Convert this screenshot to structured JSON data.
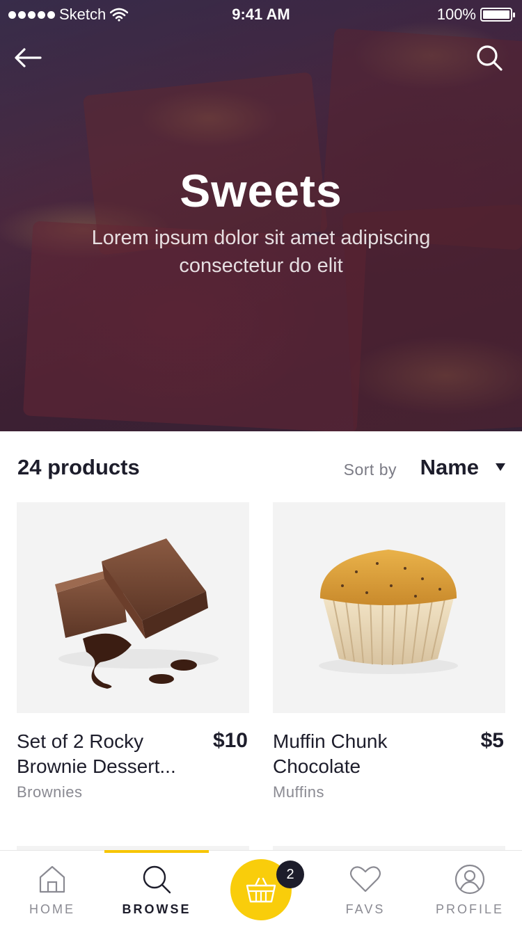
{
  "status_bar": {
    "carrier": "Sketch",
    "time": "9:41 AM",
    "battery": "100%"
  },
  "hero": {
    "title": "Sweets",
    "subtitle": "Lorem ipsum dolor sit amet adipiscing consectetur do elit",
    "back_icon": "arrow-left-icon",
    "search_icon": "search-icon"
  },
  "list": {
    "count": "24 products",
    "sort_label": "Sort by",
    "sort_value": "Name"
  },
  "products": [
    {
      "name_line1": "Set of 2 Rocky",
      "name_line2": "Brownie Dessert...",
      "price": "$10",
      "category": "Brownies"
    },
    {
      "name_line1": "Muffin Chunk",
      "name_line2": "Chocolate",
      "price": "$5",
      "category": "Muffins"
    }
  ],
  "tabbar": {
    "tabs": [
      {
        "label": "HOME",
        "icon": "home-icon"
      },
      {
        "label": "BROWSE",
        "icon": "search-icon",
        "active": true
      },
      {
        "label": "FAVS",
        "icon": "heart-icon"
      },
      {
        "label": "PROFILE",
        "icon": "profile-icon"
      }
    ],
    "cart_icon": "basket-icon",
    "cart_count": "2"
  },
  "colors": {
    "accent": "#f9cd0b",
    "text_dark": "#1d1d2b",
    "text_muted": "#8a8a92"
  }
}
